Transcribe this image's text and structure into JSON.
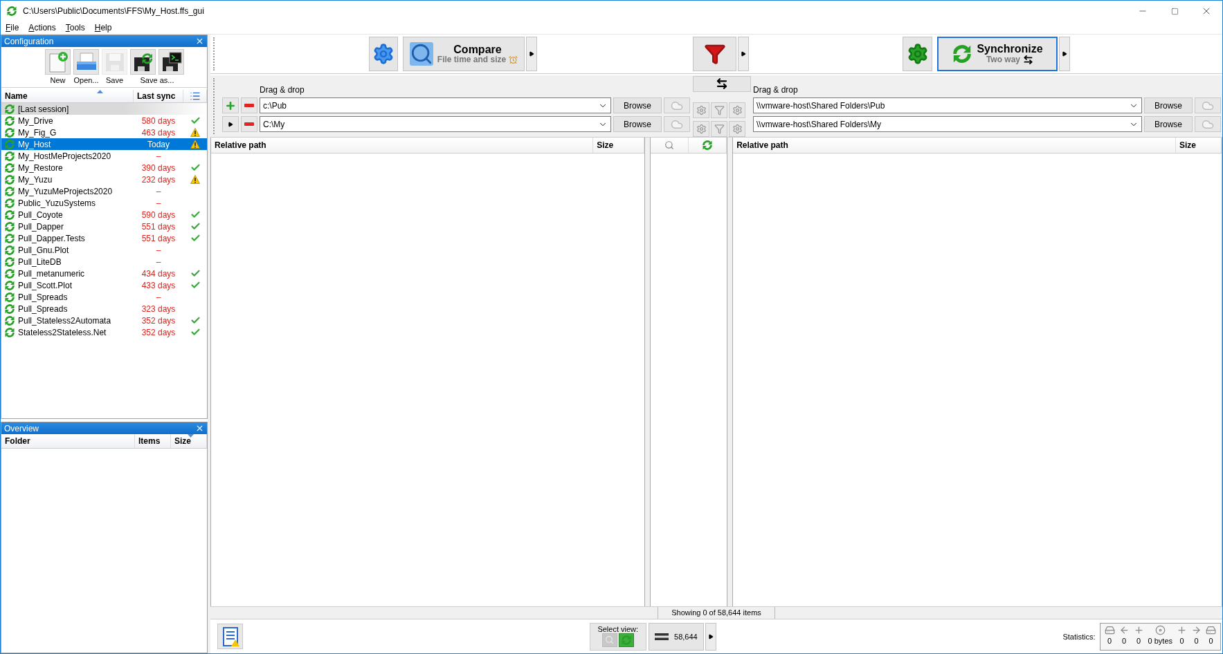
{
  "window": {
    "title": "C:\\Users\\Public\\Documents\\FFS\\My_Host.ffs_gui"
  },
  "menu": [
    "File",
    "Actions",
    "Tools",
    "Help"
  ],
  "configuration": {
    "title": "Configuration",
    "tools": [
      {
        "label": "New",
        "disabled": false,
        "icons": [
          {
            "kind": "new"
          }
        ]
      },
      {
        "label": "Open...",
        "disabled": false,
        "icons": [
          {
            "kind": "open"
          }
        ]
      },
      {
        "label": "Save",
        "disabled": true,
        "icons": [
          {
            "kind": "save"
          }
        ]
      },
      {
        "label": "Save as...",
        "disabled": false,
        "icons": [
          {
            "kind": "save_as"
          },
          {
            "kind": "save_batch"
          }
        ]
      }
    ],
    "columns": [
      "Name",
      "Last sync"
    ],
    "items": [
      {
        "kind": "session",
        "name": "[Last session]",
        "synced_ok": false,
        "warning": false,
        "selected": false
      },
      {
        "kind": "config",
        "name": "My_Drive",
        "last_sync": "580 days",
        "synced_ok": true,
        "warning": false,
        "selected": false
      },
      {
        "kind": "config",
        "name": "My_Fig_G",
        "last_sync": "463 days",
        "synced_ok": false,
        "warning": true,
        "selected": false
      },
      {
        "kind": "config",
        "name": "My_Host",
        "last_sync": "Today",
        "synced_ok": false,
        "warning": true,
        "selected": true
      },
      {
        "kind": "config",
        "name": "My_HostMeProjects2020",
        "last_sync": "–",
        "synced_ok": false,
        "warning": false,
        "selected": false
      },
      {
        "kind": "config",
        "name": "My_Restore",
        "last_sync": "390 days",
        "synced_ok": true,
        "warning": false,
        "selected": false
      },
      {
        "kind": "config",
        "name": "My_Yuzu",
        "last_sync": "232 days",
        "synced_ok": false,
        "warning": true,
        "selected": false
      },
      {
        "kind": "config",
        "name": "My_YuzuMeProjects2020",
        "last_sync": "–",
        "synced_ok": false,
        "warning": false,
        "selected": false
      },
      {
        "kind": "config",
        "name": "Public_YuzuSystems",
        "last_sync": "–",
        "synced_ok": false,
        "warning": false,
        "selected": false
      },
      {
        "kind": "config",
        "name": "Pull_Coyote",
        "last_sync": "590 days",
        "synced_ok": true,
        "warning": false,
        "selected": false
      },
      {
        "kind": "config",
        "name": "Pull_Dapper",
        "last_sync": "551 days",
        "synced_ok": true,
        "warning": false,
        "selected": false
      },
      {
        "kind": "config",
        "name": "Pull_Dapper.Tests",
        "last_sync": "551 days",
        "synced_ok": true,
        "warning": false,
        "selected": false
      },
      {
        "kind": "config",
        "name": "Pull_Gnu.Plot",
        "last_sync": "–",
        "synced_ok": false,
        "warning": false,
        "selected": false
      },
      {
        "kind": "config",
        "name": "Pull_LiteDB",
        "last_sync": "–",
        "synced_ok": false,
        "warning": false,
        "selected": false
      },
      {
        "kind": "config",
        "name": "Pull_metanumeric",
        "last_sync": "434 days",
        "synced_ok": true,
        "warning": false,
        "selected": false
      },
      {
        "kind": "config",
        "name": "Pull_Scott.Plot",
        "last_sync": "433 days",
        "synced_ok": true,
        "warning": false,
        "selected": false
      },
      {
        "kind": "config",
        "name": "Pull_Spreads",
        "last_sync": "–",
        "synced_ok": false,
        "warning": false,
        "selected": false
      },
      {
        "kind": "config",
        "name": "Pull_Spreads",
        "last_sync": "323 days",
        "synced_ok": false,
        "warning": false,
        "selected": false
      },
      {
        "kind": "config",
        "name": "Pull_Stateless2Automata",
        "last_sync": "352 days",
        "synced_ok": true,
        "warning": false,
        "selected": false
      },
      {
        "kind": "config",
        "name": "Stateless2Stateless.Net",
        "last_sync": "352 days",
        "synced_ok": true,
        "warning": false,
        "selected": false
      }
    ]
  },
  "overview": {
    "title": "Overview",
    "columns": [
      "Folder",
      "Items",
      "Size"
    ]
  },
  "toolbar": {
    "compare": {
      "label": "Compare",
      "sub": "File time and size"
    },
    "synchronize": {
      "label": "Synchronize",
      "sub": "Two way"
    }
  },
  "folder_pairs": {
    "left_header": "Drag & drop",
    "right_header": "Drag & drop",
    "pairs": [
      {
        "kind": "add",
        "left": "c:\\Pub",
        "left_browse": "Browse",
        "right": "\\\\vmware-host\\Shared Folders\\Pub",
        "right_browse": "Browse"
      },
      {
        "kind": "expand",
        "left": "C:\\My",
        "left_browse": "Browse",
        "right": "\\\\vmware-host\\Shared Folders\\My",
        "right_browse": "Browse"
      }
    ]
  },
  "grid": {
    "left_columns": [
      "Relative path",
      "Size"
    ],
    "right_columns": [
      "Relative path",
      "Size"
    ]
  },
  "status": "Showing 0 of 58,644 items",
  "bottom": {
    "select_view": "Select view:",
    "views": [
      {
        "kind": "compare",
        "selected": false
      },
      {
        "kind": "sync",
        "selected": true
      }
    ],
    "count": "58,644",
    "statistics_label": "Statistics:",
    "stats": [
      {
        "kind": "delete_left",
        "value": "0"
      },
      {
        "kind": "update_left",
        "value": "0"
      },
      {
        "kind": "create_left",
        "value": "0"
      },
      {
        "kind": "data",
        "value": "0 bytes"
      },
      {
        "kind": "create_right",
        "value": "0"
      },
      {
        "kind": "update_right",
        "value": "0"
      },
      {
        "kind": "delete_right",
        "value": "0"
      }
    ]
  }
}
